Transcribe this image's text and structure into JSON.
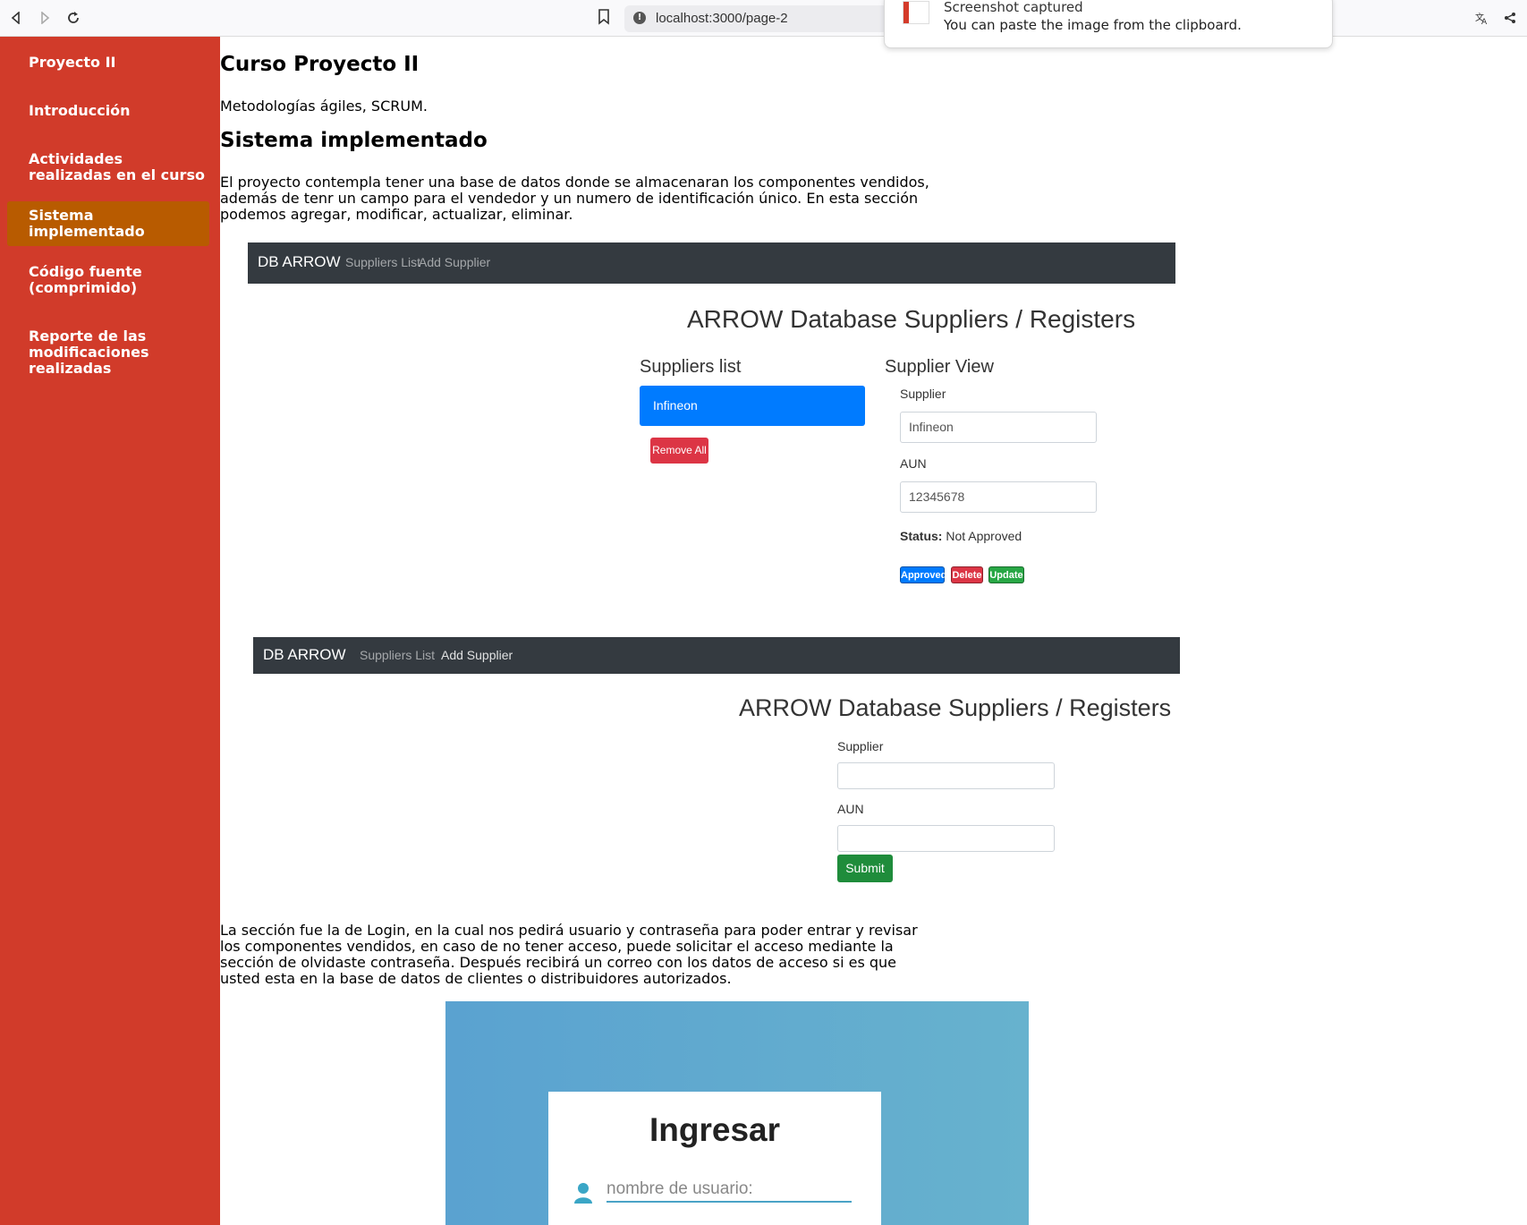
{
  "browser": {
    "url": "localhost:3000/page-2",
    "nav_icons": [
      "back-icon",
      "forward-icon",
      "reload-icon"
    ],
    "notification": {
      "title": "Screenshot captured",
      "body": "You can paste the image from the clipboard."
    }
  },
  "sidebar": {
    "items": [
      {
        "label": "Proyecto II"
      },
      {
        "label": "Introducción"
      },
      {
        "label": "Actividades realizadas en el curso"
      },
      {
        "label": "Sistema implementado",
        "active": true
      },
      {
        "label": "Código fuente (comprimido)"
      },
      {
        "label": "Reporte de las modificaciones realizadas"
      }
    ],
    "bg_color": "#d13b2a",
    "active_color": "#b85b00"
  },
  "main": {
    "title": "Curso Proyecto II",
    "subtitle": "Metodologías ágiles, SCRUM.",
    "section_title": "Sistema implementado",
    "para1": "El proyecto contempla tener una base de datos donde se almacenaran los componentes vendidos, además de tenr un campo para el vendedor y un numero de identificación único. En esta sección podemos agregar, modificar, actualizar, eliminar.",
    "para2": "La sección fue la de Login, en la cual nos pedirá usuario y contraseña para poder entrar y revisar los componentes vendidos, en caso de no tener acceso, puede solicitar el acceso mediante la sección de olvidaste contraseña. Después recibirá un correo con los datos de acceso si es que usted esta en la base de datos de clientes o distribuidores autorizados."
  },
  "app1": {
    "brand": "DB ARROW",
    "nav_links": [
      "Suppliers List",
      "Add Supplier"
    ],
    "heading": "ARROW Database Suppliers / Registers",
    "list_title": "Suppliers list",
    "list_items": [
      "Infineon"
    ],
    "remove_all": "Remove All",
    "view_title": "Supplier View",
    "supplier_label": "Supplier",
    "supplier_value": "Infineon",
    "aun_label": "AUN",
    "aun_value": "12345678",
    "status_label": "Status:",
    "status_value": "Not Approved",
    "buttons": {
      "approved": "Approved",
      "delete": "Delete",
      "update": "Update"
    }
  },
  "app2": {
    "brand": "DB ARROW",
    "nav_links": [
      "Suppliers List",
      "Add Supplier"
    ],
    "heading": "ARROW Database Suppliers / Registers",
    "supplier_label": "Supplier",
    "aun_label": "AUN",
    "submit": "Submit"
  },
  "login": {
    "title": "Ingresar",
    "username_placeholder": "nombre de usuario:"
  }
}
